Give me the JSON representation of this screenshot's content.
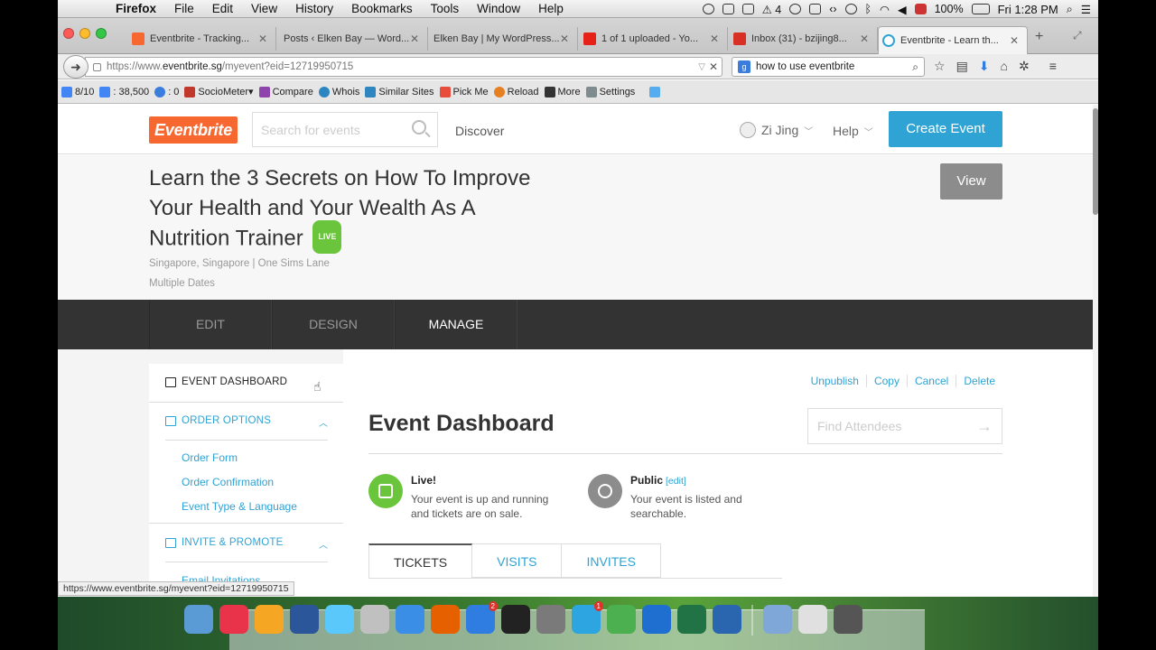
{
  "menubar": {
    "app": "Firefox",
    "items": [
      "File",
      "Edit",
      "View",
      "History",
      "Bookmarks",
      "Tools",
      "Window",
      "Help"
    ],
    "notification_count": "4",
    "battery": "100%",
    "clock": "Fri 1:28 PM"
  },
  "tabs": [
    {
      "title": "Eventbrite - Tracking...",
      "color": "#f6682f"
    },
    {
      "title": "Posts ‹ Elken Bay — Word...",
      "color": ""
    },
    {
      "title": "Elken Bay | My WordPress...",
      "color": ""
    },
    {
      "title": "1 of 1 uploaded - Yo...",
      "color": "#e62117"
    },
    {
      "title": "Inbox (31) - bzijing8...",
      "color": "#d93025"
    },
    {
      "title": "Eventbrite - Learn th...",
      "color": "#2ea3d4",
      "active": true
    }
  ],
  "navbar": {
    "url_pre": "https://www.",
    "url_host": "eventbrite.sg",
    "url_path": "/myevent?eid=12719950715",
    "search_value": "how to use eventbrite"
  },
  "bookmarks": [
    {
      "label": "8/10",
      "color": "#4285f4"
    },
    {
      "label": ": 38,500",
      "color": "#4285f4"
    },
    {
      "label": ": 0",
      "color": "#3b7ddd"
    },
    {
      "label": "SocioMeter▾",
      "color": "#c0392b"
    },
    {
      "label": "Compare",
      "color": "#8e44ad"
    },
    {
      "label": "Whois",
      "color": "#2e86c1"
    },
    {
      "label": "Similar Sites",
      "color": "#2e86c1"
    },
    {
      "label": "Pick Me",
      "color": "#e74c3c"
    },
    {
      "label": "Reload",
      "color": "#e67e22"
    },
    {
      "label": "More",
      "color": "#333333"
    },
    {
      "label": "Settings",
      "color": "#7f8c8d"
    },
    {
      "label": "",
      "color": "#55acee"
    }
  ],
  "eb": {
    "logo": "Eventbrite",
    "search_placeholder": "Search for events",
    "discover": "Discover",
    "user": "Zi Jing",
    "help": "Help",
    "create": "Create Event",
    "accent": "#2ea3d4"
  },
  "event": {
    "title": "Learn the 3 Secrets on How To Improve Your Health and Your Wealth As A Nutrition Trainer",
    "live_badge": "LIVE",
    "location": "Singapore, Singapore | One Sims Lane",
    "dates": "Multiple Dates",
    "view": "View"
  },
  "mgmt_tabs": [
    "EDIT",
    "DESIGN",
    "MANAGE"
  ],
  "sidenav": {
    "dashboard": "EVENT DASHBOARD",
    "order_options": "ORDER OPTIONS",
    "order_items": [
      "Order Form",
      "Order Confirmation",
      "Event Type & Language"
    ],
    "invite_promote": "INVITE & PROMOTE",
    "invite_items": [
      "Email Invitations"
    ]
  },
  "dashboard": {
    "actions": [
      "Unpublish",
      "Copy",
      "Cancel",
      "Delete"
    ],
    "title": "Event Dashboard",
    "find_placeholder": "Find Attendees",
    "live_title": "Live!",
    "live_desc": "Your event is up and running and tickets are on sale.",
    "public_title": "Public",
    "public_edit": "[edit]",
    "public_desc": "Your event is listed and searchable.",
    "tabs": [
      "TICKETS",
      "VISITS",
      "INVITES"
    ]
  },
  "statusbar": {
    "url": "https://www.eventbrite.sg/myevent?eid=12719950715"
  },
  "dock": {
    "icons": [
      "finder-icon",
      "itunes-icon",
      "ibooks-icon",
      "word-icon",
      "messages-icon",
      "preview-icon",
      "safari-icon",
      "firefox-icon",
      "downloads-icon",
      "terminal-icon",
      "photo-icon",
      "telegram-icon",
      "chrome-icon",
      "keynote-icon",
      "excel-icon",
      "quicktime-icon",
      "applications-folder-icon",
      "document-icon",
      "trash-icon"
    ],
    "colors": [
      "#5b9bd5",
      "#e8334a",
      "#f5a623",
      "#2b579a",
      "#5ac8fa",
      "#c0c0c0",
      "#3a8ee6",
      "#e66000",
      "#2f7de1",
      "#222222",
      "#7a7a7a",
      "#2ca5e0",
      "#4caf50",
      "#1f6fd1",
      "#217346",
      "#2a65b0",
      "#7fa7d8",
      "#e0e0e0",
      "#555555"
    ],
    "badges": {
      "downloads-icon": "2",
      "telegram-icon": "1"
    }
  }
}
